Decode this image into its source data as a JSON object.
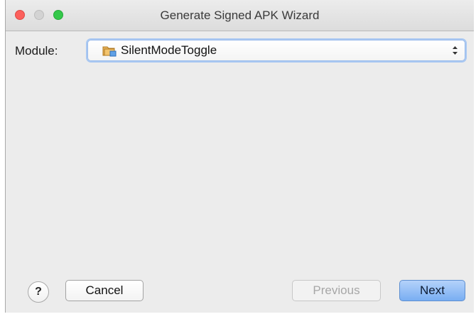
{
  "window": {
    "title": "Generate Signed APK Wizard"
  },
  "module": {
    "label": "Module:",
    "selected_value": "SilentModeToggle",
    "icon": "module-folder-icon"
  },
  "footer": {
    "help_label": "?",
    "cancel_label": "Cancel",
    "previous_label": "Previous",
    "next_label": "Next"
  },
  "colors": {
    "close": "#fc605c",
    "minimize": "#d3d3d3",
    "zoom": "#34c84a",
    "focus_ring": "#a9c8f2",
    "primary_button": "#79aef2"
  }
}
